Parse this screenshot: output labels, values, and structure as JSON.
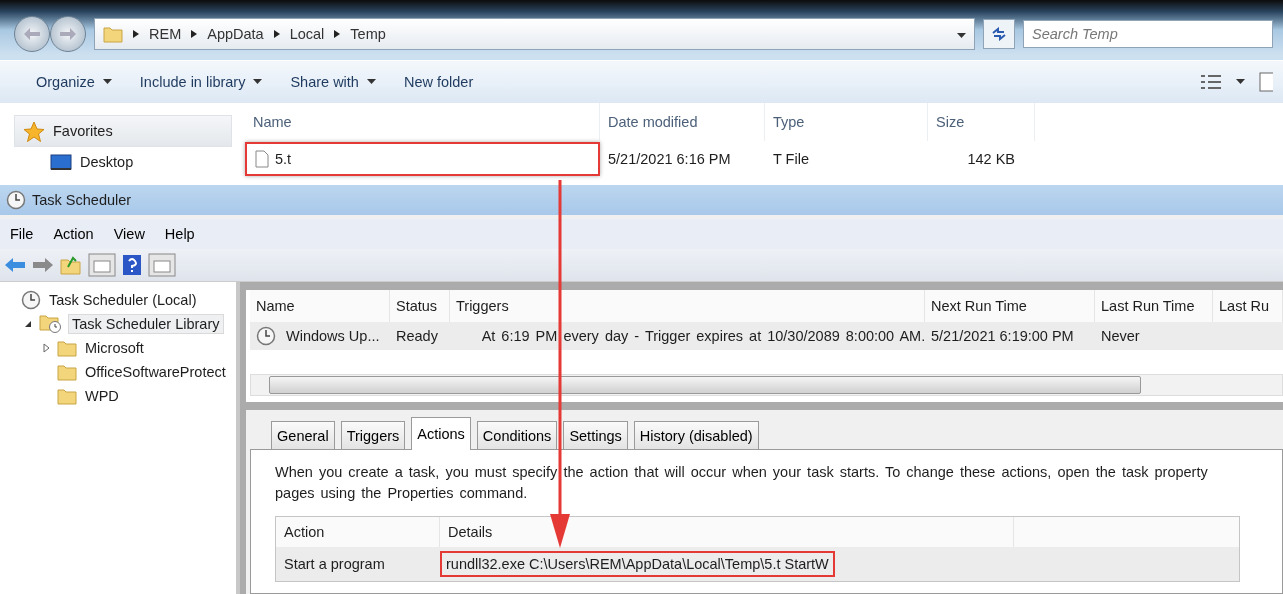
{
  "explorer": {
    "breadcrumb": [
      "REM",
      "AppData",
      "Local",
      "Temp"
    ],
    "search": {
      "placeholder": "Search Temp"
    },
    "toolbar": [
      {
        "label": "Organize",
        "dropdown": true
      },
      {
        "label": "Include in library",
        "dropdown": true
      },
      {
        "label": "Share with",
        "dropdown": true
      },
      {
        "label": "New folder",
        "dropdown": false
      }
    ],
    "nav": [
      {
        "label": "Favorites",
        "kind": "star"
      },
      {
        "label": "Desktop",
        "kind": "desktop"
      }
    ],
    "columns": [
      "Name",
      "Date modified",
      "Type",
      "Size"
    ],
    "files": [
      {
        "name": "5.t",
        "date": "5/21/2021 6:16 PM",
        "type": "T File",
        "size": "142 KB",
        "highlighted": true
      }
    ]
  },
  "scheduler": {
    "title": "Task Scheduler",
    "menu": [
      "File",
      "Action",
      "View",
      "Help"
    ],
    "tree": [
      {
        "label": "Task Scheduler (Local)",
        "kind": "clock",
        "expandable": false,
        "selected": false,
        "children": [
          {
            "label": "Task Scheduler Library",
            "kind": "library",
            "expandable": true,
            "expanded": true,
            "selected": true,
            "children": [
              {
                "label": "Microsoft",
                "kind": "folder",
                "expandable": true,
                "expanded": false,
                "selected": false
              },
              {
                "label": "OfficeSoftwareProtect",
                "kind": "folder",
                "expandable": false,
                "selected": false
              },
              {
                "label": "WPD",
                "kind": "folder",
                "expandable": false,
                "selected": false
              }
            ]
          }
        ]
      }
    ],
    "task_columns": [
      "Name",
      "Status",
      "Triggers",
      "Next Run Time",
      "Last Run Time",
      "Last Ru"
    ],
    "tasks": [
      {
        "cells": [
          "Windows Up...",
          "Ready",
          "At 6:19 PM every day - Trigger expires at 10/30/2089 8:00:00 AM.",
          "5/21/2021 6:19:00 PM",
          "Never"
        ]
      }
    ],
    "tabs": [
      {
        "label": "General",
        "selected": false
      },
      {
        "label": "Triggers",
        "selected": false
      },
      {
        "label": "Actions",
        "selected": true
      },
      {
        "label": "Conditions",
        "selected": false
      },
      {
        "label": "Settings",
        "selected": false
      },
      {
        "label": "History (disabled)",
        "selected": false
      }
    ],
    "description": "When you create a task, you must specify the action that will occur when your task starts.  To change these actions, open the task property pages using the Properties command.",
    "action_columns": [
      "Action",
      "Details"
    ],
    "actions": [
      {
        "action": "Start a program",
        "details": "rundll32.exe C:\\Users\\REM\\AppData\\Local\\Temp\\5.t StartW",
        "highlighted": true
      }
    ]
  }
}
